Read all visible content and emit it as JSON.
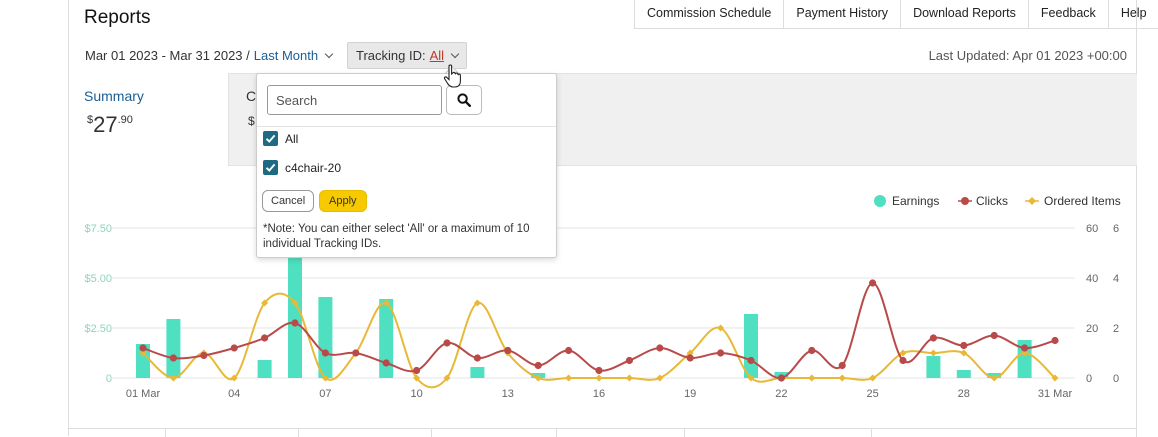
{
  "header": {
    "title": "Reports",
    "nav": [
      "Commission Schedule",
      "Payment History",
      "Download Reports",
      "Feedback",
      "Help"
    ]
  },
  "filters": {
    "date_range": "Mar 01 2023 - Mar 31 2023 /",
    "period_link": "Last Month",
    "tracking_label": "Tracking ID:",
    "tracking_value": "All",
    "last_updated": "Last Updated: Apr 01 2023 +00:00"
  },
  "summary": {
    "label": "Summary",
    "currency": "$",
    "whole": "27",
    "cents": ".90",
    "second_card_label": "C",
    "second_card_value": "$"
  },
  "dropdown": {
    "search_placeholder": "Search",
    "options": [
      {
        "label": "All",
        "checked": true
      },
      {
        "label": "c4chair-20",
        "checked": true
      }
    ],
    "cancel_label": "Cancel",
    "apply_label": "Apply",
    "note": "*Note: You can either select 'All' or a maximum of 10 individual Tracking IDs."
  },
  "colors": {
    "earnings": "#4ee0c0",
    "clicks": "#b84a4a",
    "ordered_items": "#e8b836",
    "link": "#1a5e96",
    "apply": "#f7ca00"
  },
  "chart_data": {
    "type": "bar+line",
    "legend": [
      "Earnings",
      "Clicks",
      "Ordered Items"
    ],
    "legend_position": "top-right",
    "x_tick_labels": [
      "01 Mar",
      "04",
      "07",
      "10",
      "13",
      "16",
      "19",
      "22",
      "25",
      "28",
      "31 Mar"
    ],
    "y_left_ticks": [
      "$7.50",
      "$5.00",
      "$2.50",
      "0"
    ],
    "y_right1_ticks": [
      "60",
      "40",
      "20",
      "0"
    ],
    "y_right2_ticks": [
      "6",
      "4",
      "2",
      "0"
    ],
    "y_left_range": [
      0,
      7.5
    ],
    "y_right1_range": [
      0,
      60
    ],
    "y_right2_range": [
      0,
      6
    ],
    "days": [
      1,
      2,
      3,
      4,
      5,
      6,
      7,
      8,
      9,
      10,
      11,
      12,
      13,
      14,
      15,
      16,
      17,
      18,
      19,
      20,
      21,
      22,
      23,
      24,
      25,
      26,
      27,
      28,
      29,
      30,
      31
    ],
    "series": [
      {
        "name": "Earnings",
        "axis": "left",
        "values": [
          1.7,
          2.95,
          0,
          0,
          0.9,
          7.5,
          4.05,
          0,
          3.95,
          0,
          0,
          0.55,
          0,
          0.25,
          0,
          0,
          0,
          0,
          0,
          0,
          3.2,
          0.3,
          0,
          0,
          0,
          0,
          1.1,
          0.4,
          0.25,
          1.9,
          0
        ]
      },
      {
        "name": "Clicks",
        "axis": "right1",
        "values": [
          12,
          8,
          9,
          12,
          16,
          22,
          10,
          10,
          6,
          3,
          14,
          8,
          11,
          5,
          11,
          3,
          7,
          12,
          8,
          10,
          7,
          0,
          11,
          5,
          38,
          7,
          16,
          13,
          17,
          12,
          15
        ]
      },
      {
        "name": "Ordered Items",
        "axis": "right2",
        "values": [
          1,
          0,
          1,
          0,
          3,
          3,
          0,
          1,
          3,
          0,
          0,
          3,
          1,
          0,
          0,
          0,
          0,
          0,
          1,
          2,
          0,
          0,
          0,
          0,
          0,
          1,
          1,
          1,
          0,
          1,
          0
        ]
      }
    ]
  }
}
